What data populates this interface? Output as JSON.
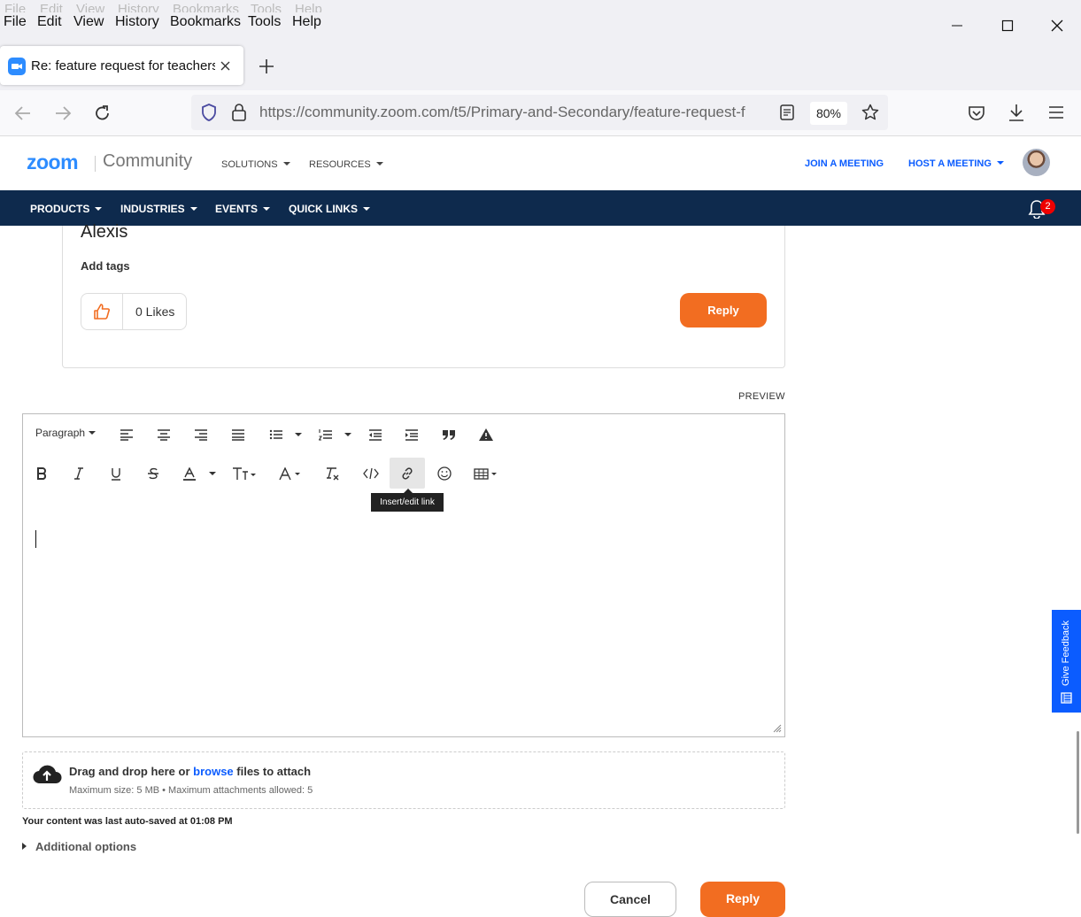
{
  "browser": {
    "ghost_menu": [
      "File",
      "Edit",
      "View",
      "History",
      "Bookmarks",
      "Tools",
      "Help"
    ],
    "menu": [
      "File",
      "Edit",
      "View",
      "History",
      "Bookmarks",
      "Tools",
      "Help"
    ],
    "tab_title": "Re: feature request for teachers",
    "url": "https://community.zoom.com/t5/Primary-and-Secondary/feature-request-f",
    "zoom": "80%"
  },
  "site": {
    "logo": "zoom",
    "community": "Community",
    "header_nav": [
      "SOLUTIONS",
      "RESOURCES"
    ],
    "join_meeting": "JOIN A MEETING",
    "host_meeting": "HOST A MEETING",
    "main_nav": [
      "PRODUCTS",
      "INDUSTRIES",
      "EVENTS",
      "QUICK LINKS"
    ],
    "notification_count": "2"
  },
  "post": {
    "signature": "Alexis",
    "add_tags": "Add tags",
    "likes": "0 Likes",
    "reply": "Reply"
  },
  "editor": {
    "preview": "PREVIEW",
    "paragraph": "Paragraph",
    "tooltip": "Insert/edit link"
  },
  "attach": {
    "prefix": "Drag and drop here or ",
    "browse": "browse",
    "suffix": " files to attach",
    "limits": "Maximum size: 5 MB • Maximum attachments allowed: 5"
  },
  "autosave": "Your content was last auto-saved at 01:08 PM",
  "additional_options": "Additional options",
  "actions": {
    "cancel": "Cancel",
    "reply": "Reply"
  },
  "feedback": "Give Feedback",
  "colors": {
    "accent": "#f26d21",
    "nav": "#0e2a4d",
    "brand": "#2d8cff",
    "link": "#0b5cff"
  }
}
